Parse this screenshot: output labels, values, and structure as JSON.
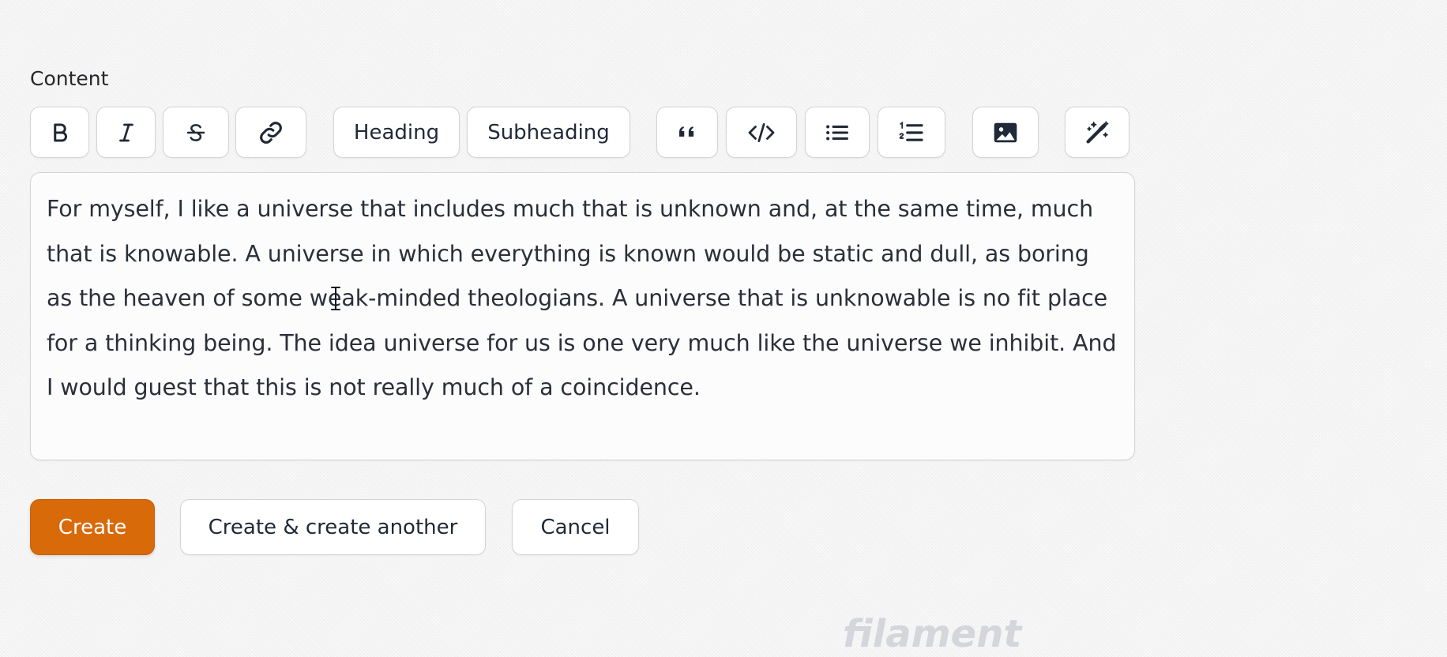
{
  "form": {
    "content_label": "Content"
  },
  "toolbar": {
    "bold_icon": "bold-icon",
    "italic_icon": "italic-icon",
    "strike_icon": "strikethrough-icon",
    "link_icon": "link-icon",
    "heading_label": "Heading",
    "subheading_label": "Subheading",
    "blockquote_icon": "quote-icon",
    "code_icon": "code-icon",
    "bullet_list_icon": "bullet-list-icon",
    "ordered_list_icon": "ordered-list-icon",
    "image_icon": "image-icon",
    "magic_icon": "magic-wand-icon"
  },
  "editor": {
    "content": "For myself, I like a universe that includes much that is unknown and, at the same time, much that is knowable. A universe in which everything is known would be static and dull, as boring as the heaven of some weak-minded theologians. A universe that is unknowable is no fit place for a thinking being. The idea universe for us is one very much like the universe we inhibit. And I would guest that this is not really much of a coincidence."
  },
  "actions": {
    "create_label": "Create",
    "create_another_label": "Create & create another",
    "cancel_label": "Cancel"
  },
  "brand": {
    "watermark": "filament"
  },
  "colors": {
    "primary": "#d86a0a",
    "border": "#d4d4d8",
    "text": "#1f2937"
  }
}
